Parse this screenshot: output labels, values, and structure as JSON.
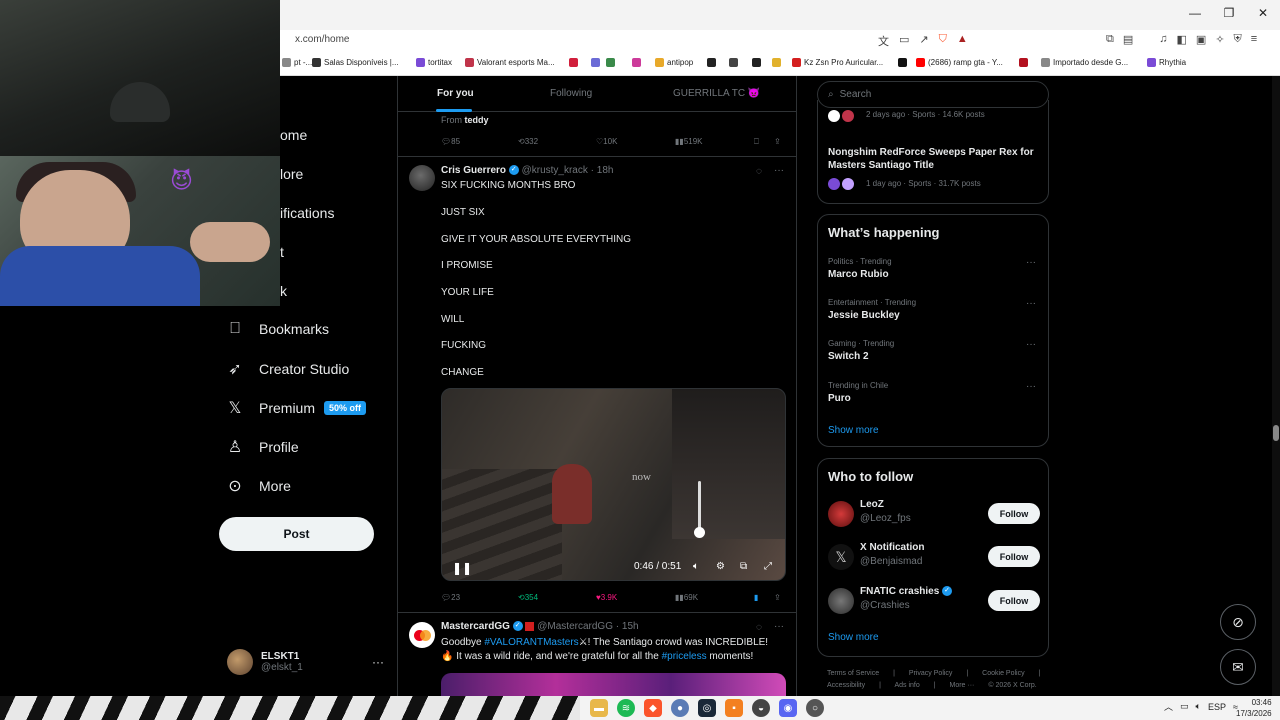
{
  "browser": {
    "window_controls": [
      "—",
      "❐",
      "✕"
    ],
    "address": "x.com/home",
    "bookmarks": [
      {
        "label": "pt -...",
        "color": "#888"
      },
      {
        "label": "Salas Disponíveis |...",
        "color": "#333"
      },
      {
        "label": "tortitax",
        "color": "#7a4bd6"
      },
      {
        "label": "Valorant esports Ma...",
        "color": "#c0344a"
      },
      {
        "label": "",
        "color": "#d11f3c"
      },
      {
        "label": "",
        "color": "#6b6bd6"
      },
      {
        "label": "",
        "color": "#3a8a4a"
      },
      {
        "label": "",
        "color": "#cc3b9a"
      },
      {
        "label": "antipop",
        "color": "#e8a92a"
      },
      {
        "label": "",
        "color": "#222"
      },
      {
        "label": "",
        "color": "#444"
      },
      {
        "label": "",
        "color": "#222"
      },
      {
        "label": "",
        "color": "#e1b12c"
      },
      {
        "label": "Kz Zsn Pro Auricular...",
        "color": "#d41f1f"
      },
      {
        "label": "",
        "color": "#111"
      },
      {
        "label": "(2686) ramp gta - Y...",
        "color": "#ff0000"
      },
      {
        "label": "",
        "color": "#b3111f"
      },
      {
        "label": "Importado desde G...",
        "color": "#888"
      },
      {
        "label": "Rhythia",
        "color": "#7a4bd6"
      }
    ]
  },
  "nav": {
    "partial_items": [
      "ome",
      "lore",
      "ifications",
      "t",
      "k"
    ],
    "items": [
      {
        "icon": "bookmark-icon",
        "glyph": "⎕",
        "label": "Bookmarks"
      },
      {
        "icon": "rocket-icon",
        "glyph": "➶",
        "label": "Creator Studio"
      },
      {
        "icon": "x-logo-icon",
        "glyph": "𝕏",
        "label": "Premium",
        "badge": "50% off"
      },
      {
        "icon": "person-icon",
        "glyph": "♙",
        "label": "Profile"
      },
      {
        "icon": "more-circle-icon",
        "glyph": "⊙",
        "label": "More"
      }
    ],
    "post_label": "Post",
    "account": {
      "name": "ELSKT1",
      "handle": "@elskt_1",
      "more": "···"
    }
  },
  "feed": {
    "tabs": [
      "For you",
      "Following",
      "GUERRILLA TC 👿"
    ],
    "prev_tweet": {
      "from_label": "From",
      "from_user": "teddy",
      "replies": "85",
      "reposts": "332",
      "likes": "10K",
      "views": "519K"
    },
    "tweet1": {
      "name": "Cris Guerrero",
      "handle": "@krusty_krack",
      "time": "· 18h",
      "lines": [
        "SIX FUCKING MONTHS BRO",
        "JUST SIX",
        "GIVE IT YOUR ABSOLUTE EVERYTHING",
        "I PROMISE",
        "YOUR LIFE",
        "WILL",
        "FUCKING",
        "CHANGE"
      ],
      "video_overlay": "now",
      "video_time": "0:46 / 0:51",
      "replies": "23",
      "reposts": "354",
      "likes": "3.9K",
      "views": "69K",
      "repost_color": "#00ba7c",
      "like_color": "#f91880"
    },
    "tweet2": {
      "name": "MastercardGG",
      "handle": "@MastercardGG",
      "time": "· 15h",
      "line1_prefix": "Goodbye ",
      "line1_hashtag": "#VALORANTMasters",
      "line1_suffix": "! The Santiago crowd was INCREDIBLE!",
      "line2_prefix": "🔥 It was a wild ride, and we're grateful for all the ",
      "line2_hashtag": "#priceless",
      "line2_suffix": " moments!"
    }
  },
  "right": {
    "search_placeholder": "Search",
    "top_trend_meta": "2 days ago · Sports · 14.6K posts",
    "news_title": "Nongshim RedForce Sweeps Paper Rex for Masters Santiago Title",
    "news_meta": "1 day ago · Sports · 31.7K posts",
    "whats_happening": {
      "title": "What’s happening",
      "trends": [
        {
          "cat": "Politics · Trending",
          "name": "Marco Rubio"
        },
        {
          "cat": "Entertainment · Trending",
          "name": "Jessie Buckley"
        },
        {
          "cat": "Gaming · Trending",
          "name": "Switch 2"
        },
        {
          "cat": "Trending in Chile",
          "name": "Puro"
        }
      ],
      "show_more": "Show more"
    },
    "who_to_follow": {
      "title": "Who to follow",
      "accounts": [
        {
          "name": "LeoZ",
          "handle": "@Leoz_fps",
          "avatar_color": "#8a1a1a"
        },
        {
          "name": "X Notification",
          "handle": "@Benjaismad",
          "avatar_color": "#111"
        },
        {
          "name": "FNATIC crashies",
          "handle": "@Crashies",
          "avatar_color": "#3a3a3a"
        }
      ],
      "follow_label": "Follow",
      "show_more": "Show more"
    },
    "footer": {
      "line1": [
        "Terms of Service",
        "|",
        "Privacy Policy",
        "|",
        "Cookie Policy",
        "|"
      ],
      "line2": [
        "Accessibility",
        "|",
        "Ads info",
        "|",
        "More ···",
        "© 2026 X Corp."
      ]
    }
  },
  "taskbar": {
    "tray_lang": "ESP",
    "time": "03:46",
    "date": "17/3/2026"
  }
}
